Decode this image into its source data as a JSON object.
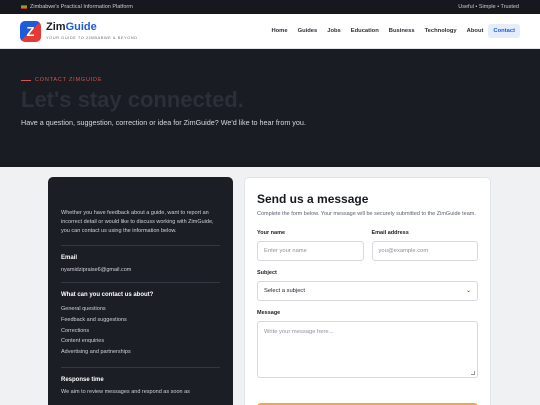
{
  "topbar": {
    "left_text": "Zimbabwe's Practical Information Platform",
    "right_text": "Useful • Simple • Trusted"
  },
  "brand": {
    "logo_letter": "Z",
    "name_part1": "Zim",
    "name_part2": "Guide",
    "tagline": "YOUR GUIDE TO ZIMBABWE & BEYOND"
  },
  "nav": {
    "items": [
      "Home",
      "Guides",
      "Jobs",
      "Education",
      "Business",
      "Technology",
      "About",
      "Contact"
    ],
    "active": "Contact"
  },
  "hero": {
    "eyebrow": "CONTACT ZIMGUIDE",
    "title": "Let's stay connected.",
    "subtitle": "Have a question, suggestion, correction or idea for ZimGuide? We'd like to hear from you."
  },
  "info": {
    "intro": "Whether you have feedback about a guide, want to report an incorrect detail or would like to discuss working with ZimGuide, you can contact us using the information below.",
    "email_heading": "Email",
    "email": "nyamidzipraise6@gmail.com",
    "about_heading": "What can you contact us about?",
    "topics": [
      "General questions",
      "Feedback and suggestions",
      "Corrections",
      "Content enquiries",
      "Advertising and partnerships"
    ],
    "response_heading": "Response time",
    "response_text": "We aim to review messages and respond as soon as"
  },
  "form": {
    "title": "Send us a message",
    "description": "Complete the form below. Your message will be securely submitted to the ZimGuide team.",
    "name_label": "Your name",
    "name_placeholder": "Enter your name",
    "email_label": "Email address",
    "email_placeholder": "you@example.com",
    "subject_label": "Subject",
    "subject_value": "Select a subject",
    "message_label": "Message",
    "message_placeholder": "Write your message here..."
  },
  "colors": {
    "accent": "#1e5bd8",
    "hero_bg": "#191c22",
    "eyebrow": "#d9534f",
    "submit": "#f0a64a"
  }
}
